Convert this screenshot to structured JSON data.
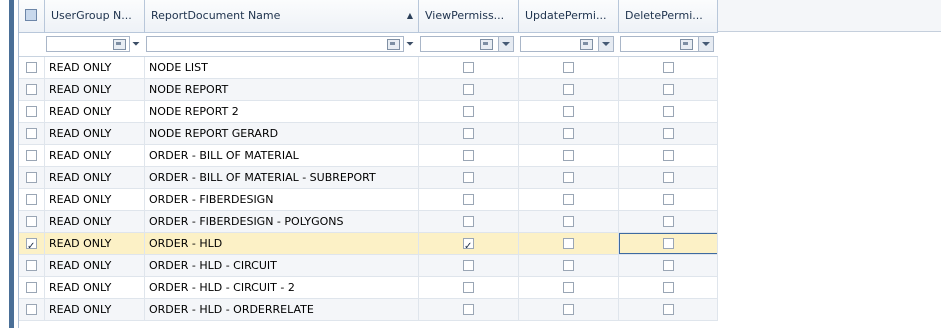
{
  "columns": [
    {
      "label": "UserGroup N..."
    },
    {
      "label": "ReportDocument Name"
    },
    {
      "label": "ViewPermiss..."
    },
    {
      "label": "UpdatePermi..."
    },
    {
      "label": "DeletePermi..."
    }
  ],
  "rows": [
    {
      "checked": false,
      "user_group": "READ ONLY",
      "report": "NODE LIST",
      "view": false,
      "update": false,
      "delete": false
    },
    {
      "checked": false,
      "user_group": "READ ONLY",
      "report": "NODE REPORT",
      "view": false,
      "update": false,
      "delete": false
    },
    {
      "checked": false,
      "user_group": "READ ONLY",
      "report": "NODE REPORT 2",
      "view": false,
      "update": false,
      "delete": false
    },
    {
      "checked": false,
      "user_group": "READ ONLY",
      "report": "NODE REPORT GERARD",
      "view": false,
      "update": false,
      "delete": false
    },
    {
      "checked": false,
      "user_group": "READ ONLY",
      "report": "ORDER - BILL OF MATERIAL",
      "view": false,
      "update": false,
      "delete": false
    },
    {
      "checked": false,
      "user_group": "READ ONLY",
      "report": "ORDER - BILL OF MATERIAL - SUBREPORT",
      "view": false,
      "update": false,
      "delete": false
    },
    {
      "checked": false,
      "user_group": "READ ONLY",
      "report": "ORDER - FIBERDESIGN",
      "view": false,
      "update": false,
      "delete": false
    },
    {
      "checked": false,
      "user_group": "READ ONLY",
      "report": "ORDER - FIBERDESIGN - POLYGONS",
      "view": false,
      "update": false,
      "delete": false
    },
    {
      "checked": true,
      "user_group": "READ ONLY",
      "report": "ORDER - HLD",
      "view": true,
      "update": false,
      "delete": false,
      "selected": true
    },
    {
      "checked": false,
      "user_group": "READ ONLY",
      "report": "ORDER - HLD - CIRCUIT",
      "view": false,
      "update": false,
      "delete": false
    },
    {
      "checked": false,
      "user_group": "READ ONLY",
      "report": "ORDER - HLD - CIRCUIT - 2",
      "view": false,
      "update": false,
      "delete": false
    },
    {
      "checked": false,
      "user_group": "READ ONLY",
      "report": "ORDER - HLD - ORDERRELATE",
      "view": false,
      "update": false,
      "delete": false
    }
  ]
}
